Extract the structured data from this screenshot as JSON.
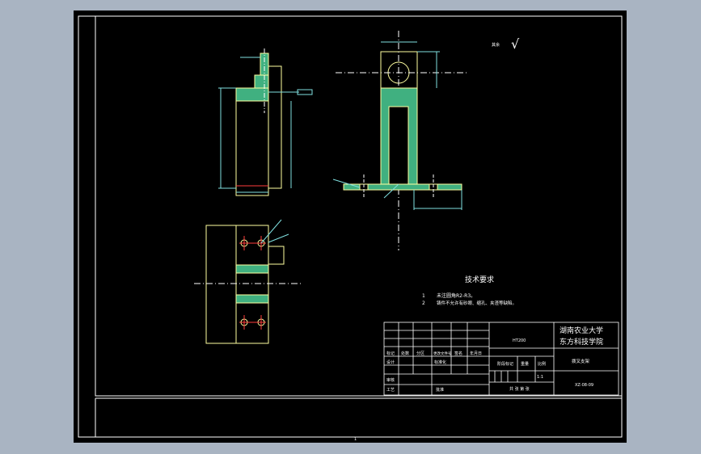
{
  "colors": {
    "window_bg": "#a9b4c2",
    "sheet_bg": "#000000",
    "frame": "#ffffff",
    "geometry": "#ffffa0",
    "centerline": "#ffffff",
    "hatch": "#40b080",
    "dimension": "#80e0e0",
    "hidden": "#ff3b3b",
    "note_text": "#ffffff",
    "tech_title": "#ffffff"
  },
  "drawing": {
    "technical_requirements": {
      "title": "技术要求",
      "items": [
        {
          "num": "1",
          "text": "未注圆角R2-R3。"
        },
        {
          "num": "2",
          "text": "铸件不允许有砂眼、缩孔、夹渣等缺陷。"
        }
      ]
    },
    "roughness_note": "其余",
    "roughness_symbol": "√",
    "bottom_mark": "1"
  },
  "title_block": {
    "school_line1": "湖南农业大学",
    "school_line2": "东方科技学院",
    "part_name": "拨叉支架",
    "drawing_number": "XZ-08-09",
    "material": "HT200",
    "weight_scale": "1:1",
    "row_labels": [
      "标记",
      "处数",
      "分区",
      "更改文件号",
      "签名",
      "年月日"
    ],
    "design_labels": [
      "设计",
      "标准化",
      "阶段标记",
      "重量",
      "比例"
    ],
    "review_labels": [
      "审核",
      "工艺",
      "批准"
    ],
    "sheet_label": "共 张 第 张"
  }
}
